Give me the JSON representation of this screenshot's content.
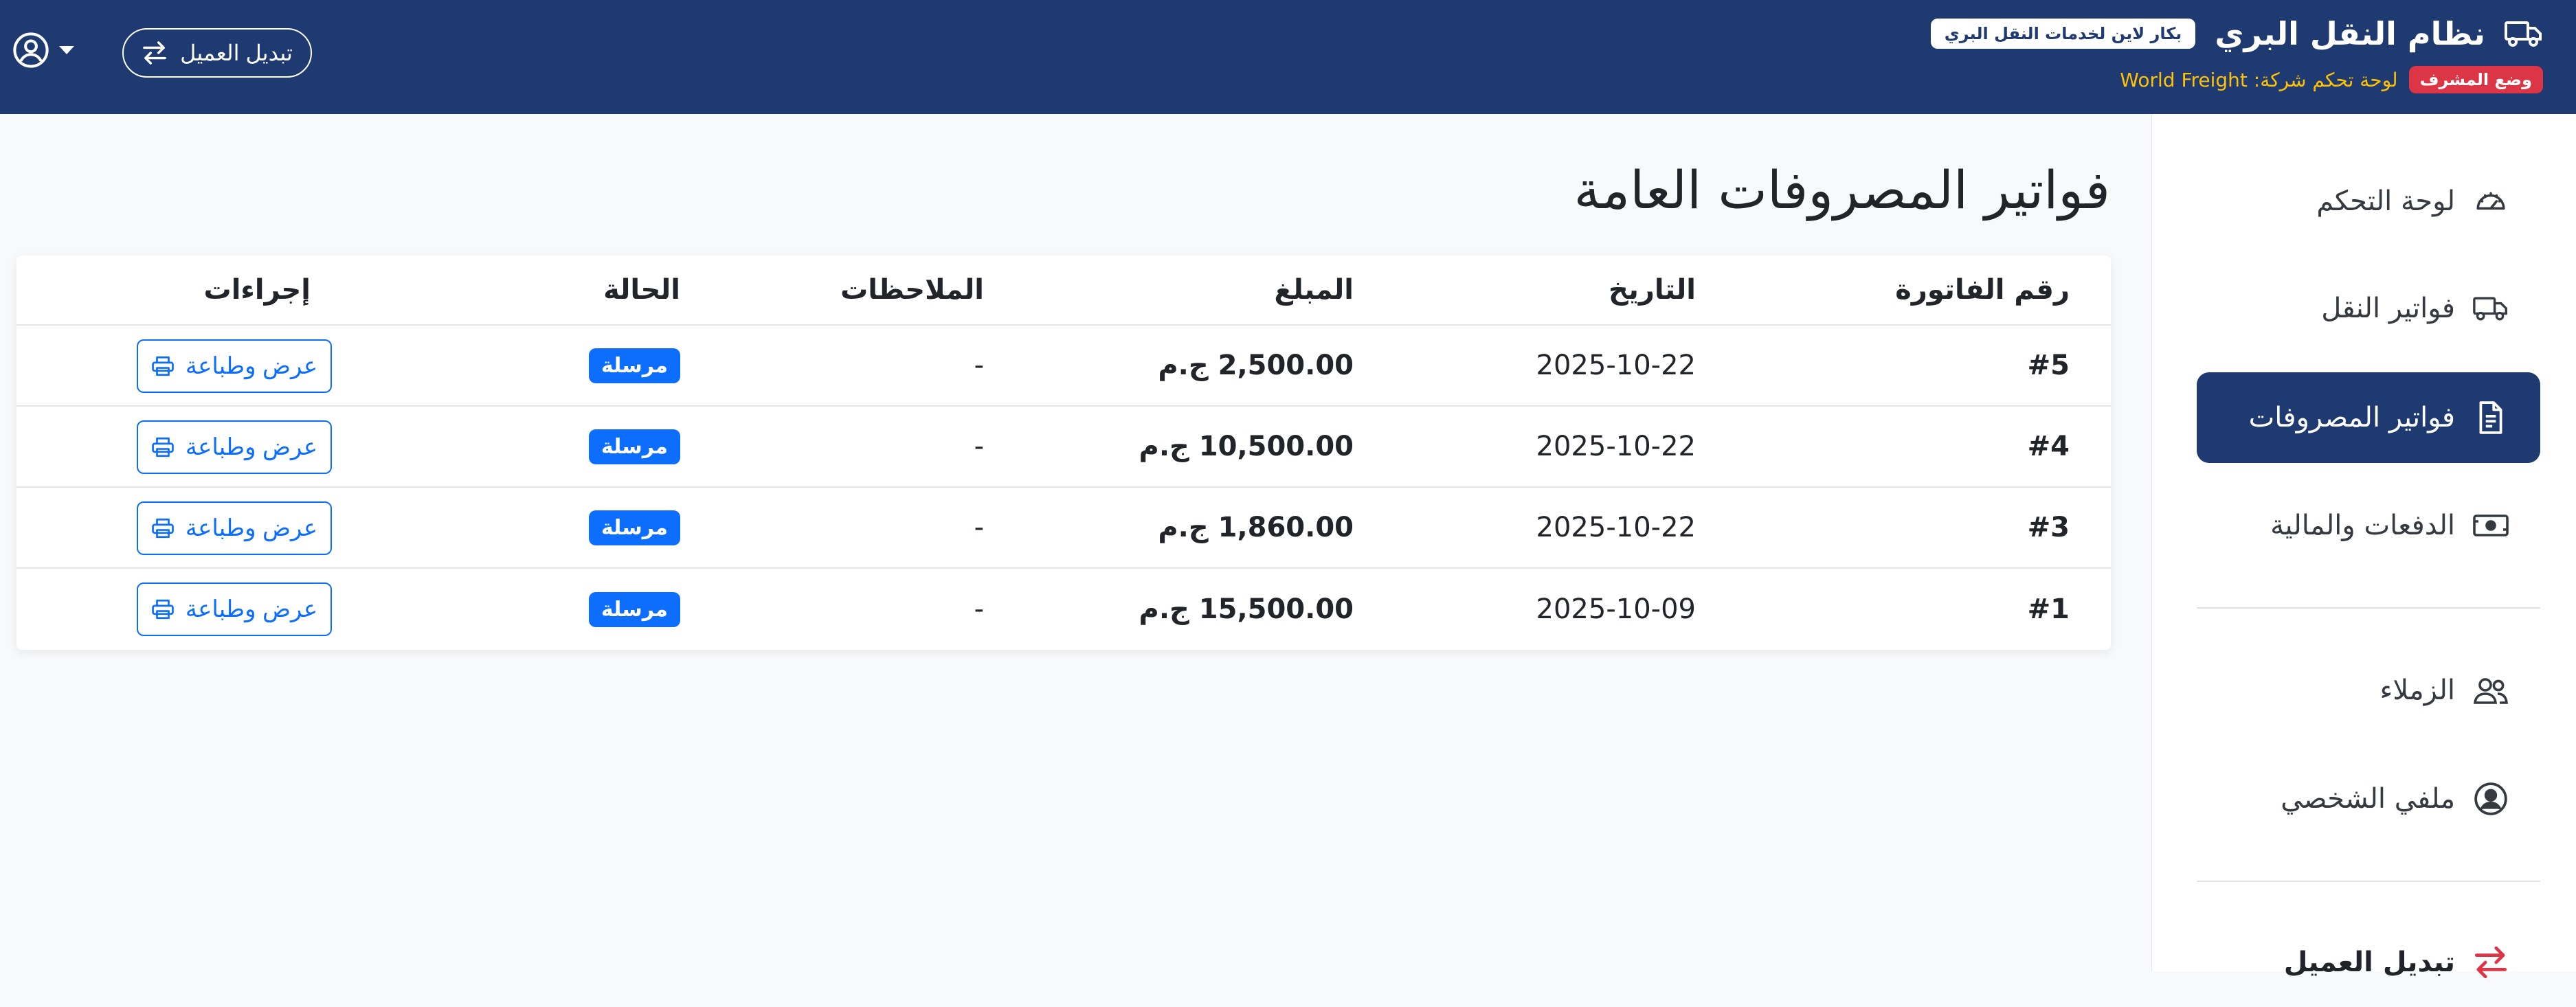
{
  "header": {
    "title": "نظام النقل البري",
    "company_pill": "بكار لاين لخدمات النقل البري",
    "admin_badge": "وضع المشرف",
    "company_line": "لوحة تحكم شركة: World Freight",
    "switch_client_label": "تبديل العميل",
    "bg_color": "#1e3a70"
  },
  "sidebar": {
    "items": [
      {
        "label": "لوحة التحكم",
        "icon": "speedometer-icon"
      },
      {
        "label": "فواتير النقل",
        "icon": "truck-icon"
      },
      {
        "label": "فواتير المصروفات",
        "icon": "file-text-icon",
        "active": true
      },
      {
        "label": "الدفعات والمالية",
        "icon": "cash-icon"
      },
      {
        "label": "الزملاء",
        "icon": "people-icon"
      },
      {
        "label": "ملفي الشخصي",
        "icon": "person-circle-icon"
      },
      {
        "label": "تبديل العميل",
        "icon": "arrow-left-right-icon"
      }
    ]
  },
  "main": {
    "title": "فواتير المصروفات العامة",
    "columns": [
      "رقم الفاتورة",
      "التاريخ",
      "المبلغ",
      "الملاحظات",
      "الحالة",
      "إجراءات"
    ],
    "rows": [
      {
        "number": "#5",
        "date": "2025-10-22",
        "amount": "2,500.00 ج.م",
        "notes": "-",
        "status": "مرسلة",
        "action": "عرض وطباعة"
      },
      {
        "number": "#4",
        "date": "2025-10-22",
        "amount": "10,500.00 ج.م",
        "notes": "-",
        "status": "مرسلة",
        "action": "عرض وطباعة"
      },
      {
        "number": "#3",
        "date": "2025-10-22",
        "amount": "1,860.00 ج.م",
        "notes": "-",
        "status": "مرسلة",
        "action": "عرض وطباعة"
      },
      {
        "number": "#1",
        "date": "2025-10-09",
        "amount": "15,500.00 ج.م",
        "notes": "-",
        "status": "مرسلة",
        "action": "عرض وطباعة"
      }
    ]
  },
  "colors": {
    "primary": "#0d6efd",
    "navy": "#1e3a70",
    "danger": "#dc3545",
    "warning": "#ffc107"
  }
}
